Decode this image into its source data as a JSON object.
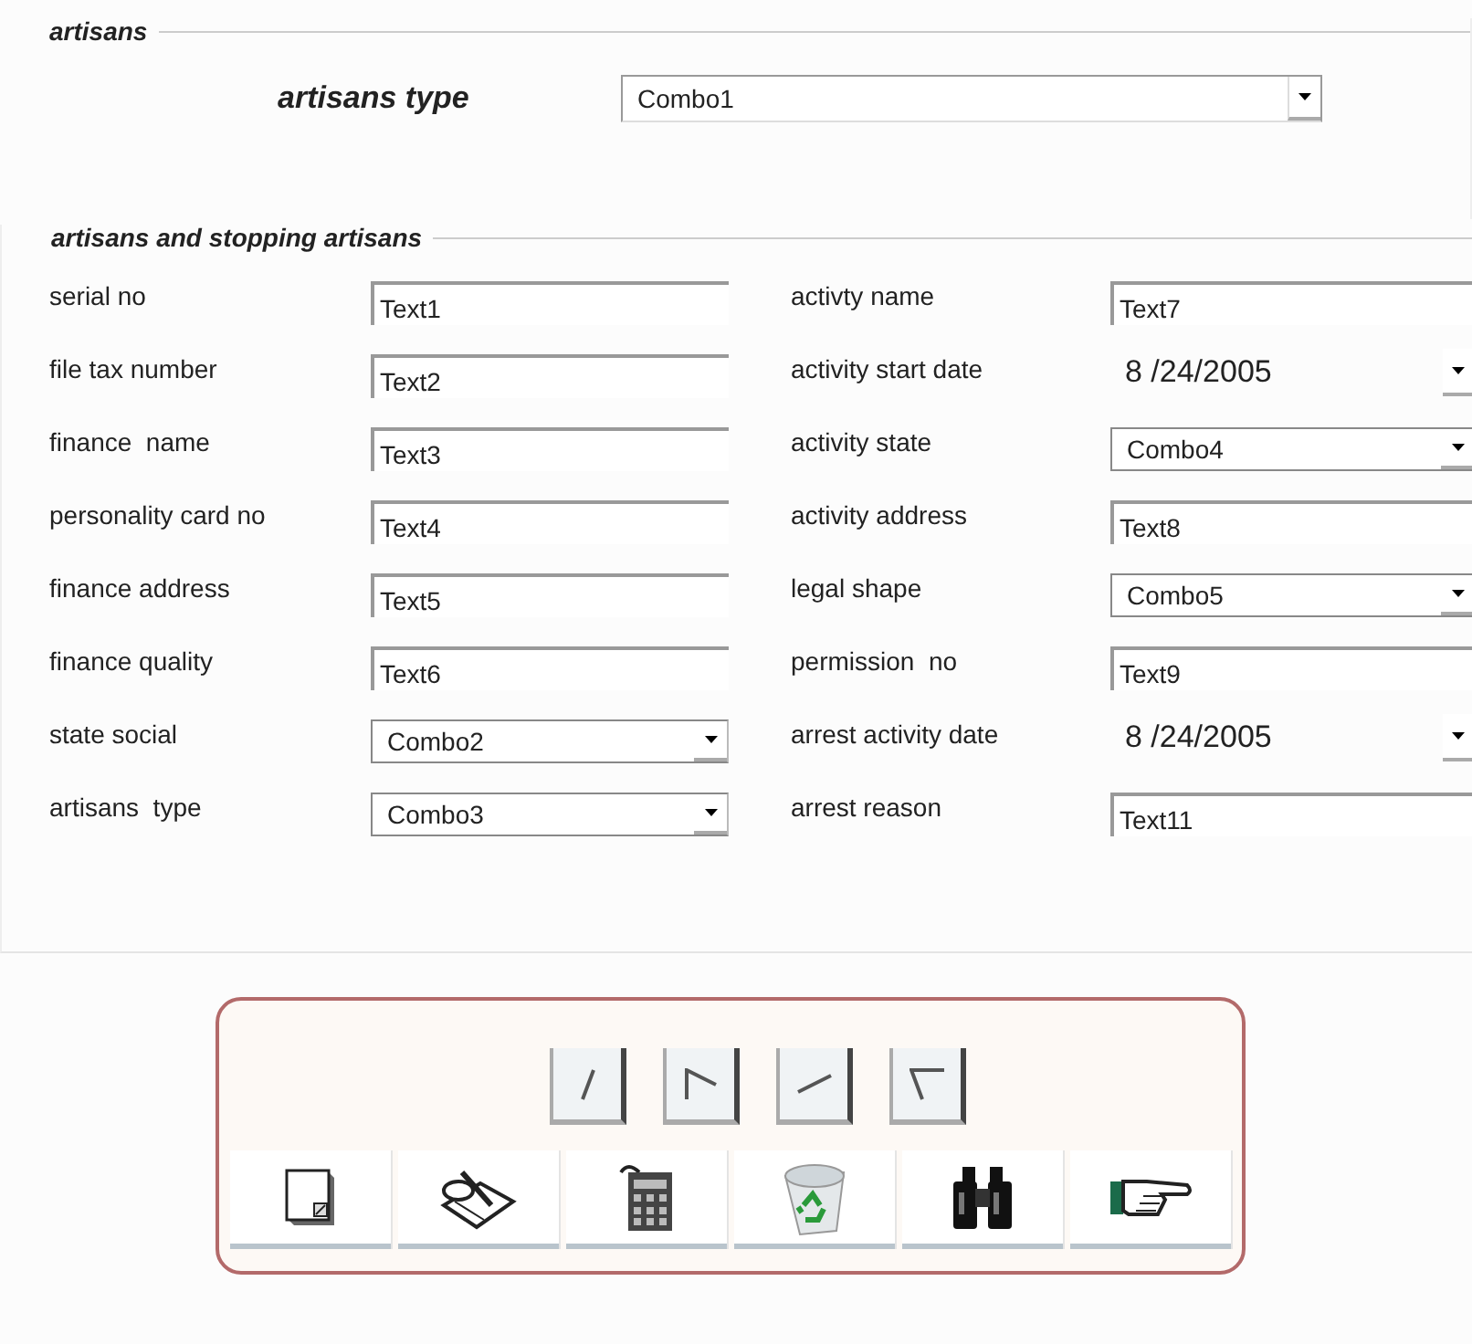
{
  "artisans_group": {
    "title": "artisans",
    "type_label": "artisans type",
    "type_combo": {
      "value": "Combo1"
    }
  },
  "details_group": {
    "title": "artisans and stopping artisans",
    "left_fields": [
      {
        "label": "serial no",
        "kind": "text",
        "value": "Text1"
      },
      {
        "label": "file tax number",
        "kind": "text",
        "value": "Text2"
      },
      {
        "label": "finance  name",
        "kind": "text",
        "value": "Text3"
      },
      {
        "label": "personality card no",
        "kind": "text",
        "value": "Text4"
      },
      {
        "label": "finance address",
        "kind": "text",
        "value": "Text5"
      },
      {
        "label": "finance quality",
        "kind": "text",
        "value": "Text6"
      },
      {
        "label": "state social",
        "kind": "combo",
        "value": "Combo2"
      },
      {
        "label": "artisans  type",
        "kind": "combo",
        "value": "Combo3"
      }
    ],
    "right_fields": [
      {
        "label": "activty name",
        "kind": "text",
        "value": "Text7"
      },
      {
        "label": "activity start date",
        "kind": "date",
        "value": "8 /24/2005"
      },
      {
        "label": "activity state",
        "kind": "combo",
        "value": "Combo4"
      },
      {
        "label": "activity address",
        "kind": "text",
        "value": "Text8"
      },
      {
        "label": "legal shape",
        "kind": "combo",
        "value": "Combo5"
      },
      {
        "label": "permission  no",
        "kind": "text",
        "value": "Text9"
      },
      {
        "label": "arrest activity date",
        "kind": "date",
        "value": "8 /24/2005"
      },
      {
        "label": "arrest reason",
        "kind": "text",
        "value": "Text11"
      }
    ]
  },
  "toolbar": {
    "nav_buttons": [
      {
        "kind": "first"
      },
      {
        "kind": "previous"
      },
      {
        "kind": "next"
      },
      {
        "kind": "last"
      }
    ],
    "action_buttons": [
      {
        "kind": "new"
      },
      {
        "kind": "edit"
      },
      {
        "kind": "calculate"
      },
      {
        "kind": "delete"
      },
      {
        "kind": "find"
      },
      {
        "kind": "go"
      }
    ]
  }
}
